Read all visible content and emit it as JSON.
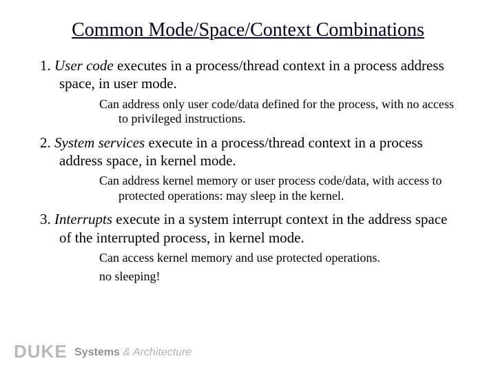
{
  "title": "Common Mode/Space/Context Combinations",
  "items": [
    {
      "num": "1. ",
      "emph": "User code",
      "rest": " executes in a process/thread context in a process address space, in user mode.",
      "subs": [
        "Can address only user code/data defined for the process, with no access to privileged instructions."
      ]
    },
    {
      "num": "2. ",
      "emph": "System services",
      "rest": " execute in a process/thread context in a process address space, in kernel mode.",
      "subs": [
        "Can address kernel memory or user process code/data, with access to protected operations: may sleep in the kernel."
      ]
    },
    {
      "num": "3. ",
      "emph": "Interrupts",
      "rest": " execute in a system interrupt context in the address space of the interrupted process, in kernel mode.",
      "subs": [
        "Can access kernel memory and use protected operations.",
        "no sleeping!"
      ]
    }
  ],
  "footer": {
    "duke": "DUKE",
    "systems": "Systems",
    "amp": " & ",
    "arch": "Architecture"
  }
}
